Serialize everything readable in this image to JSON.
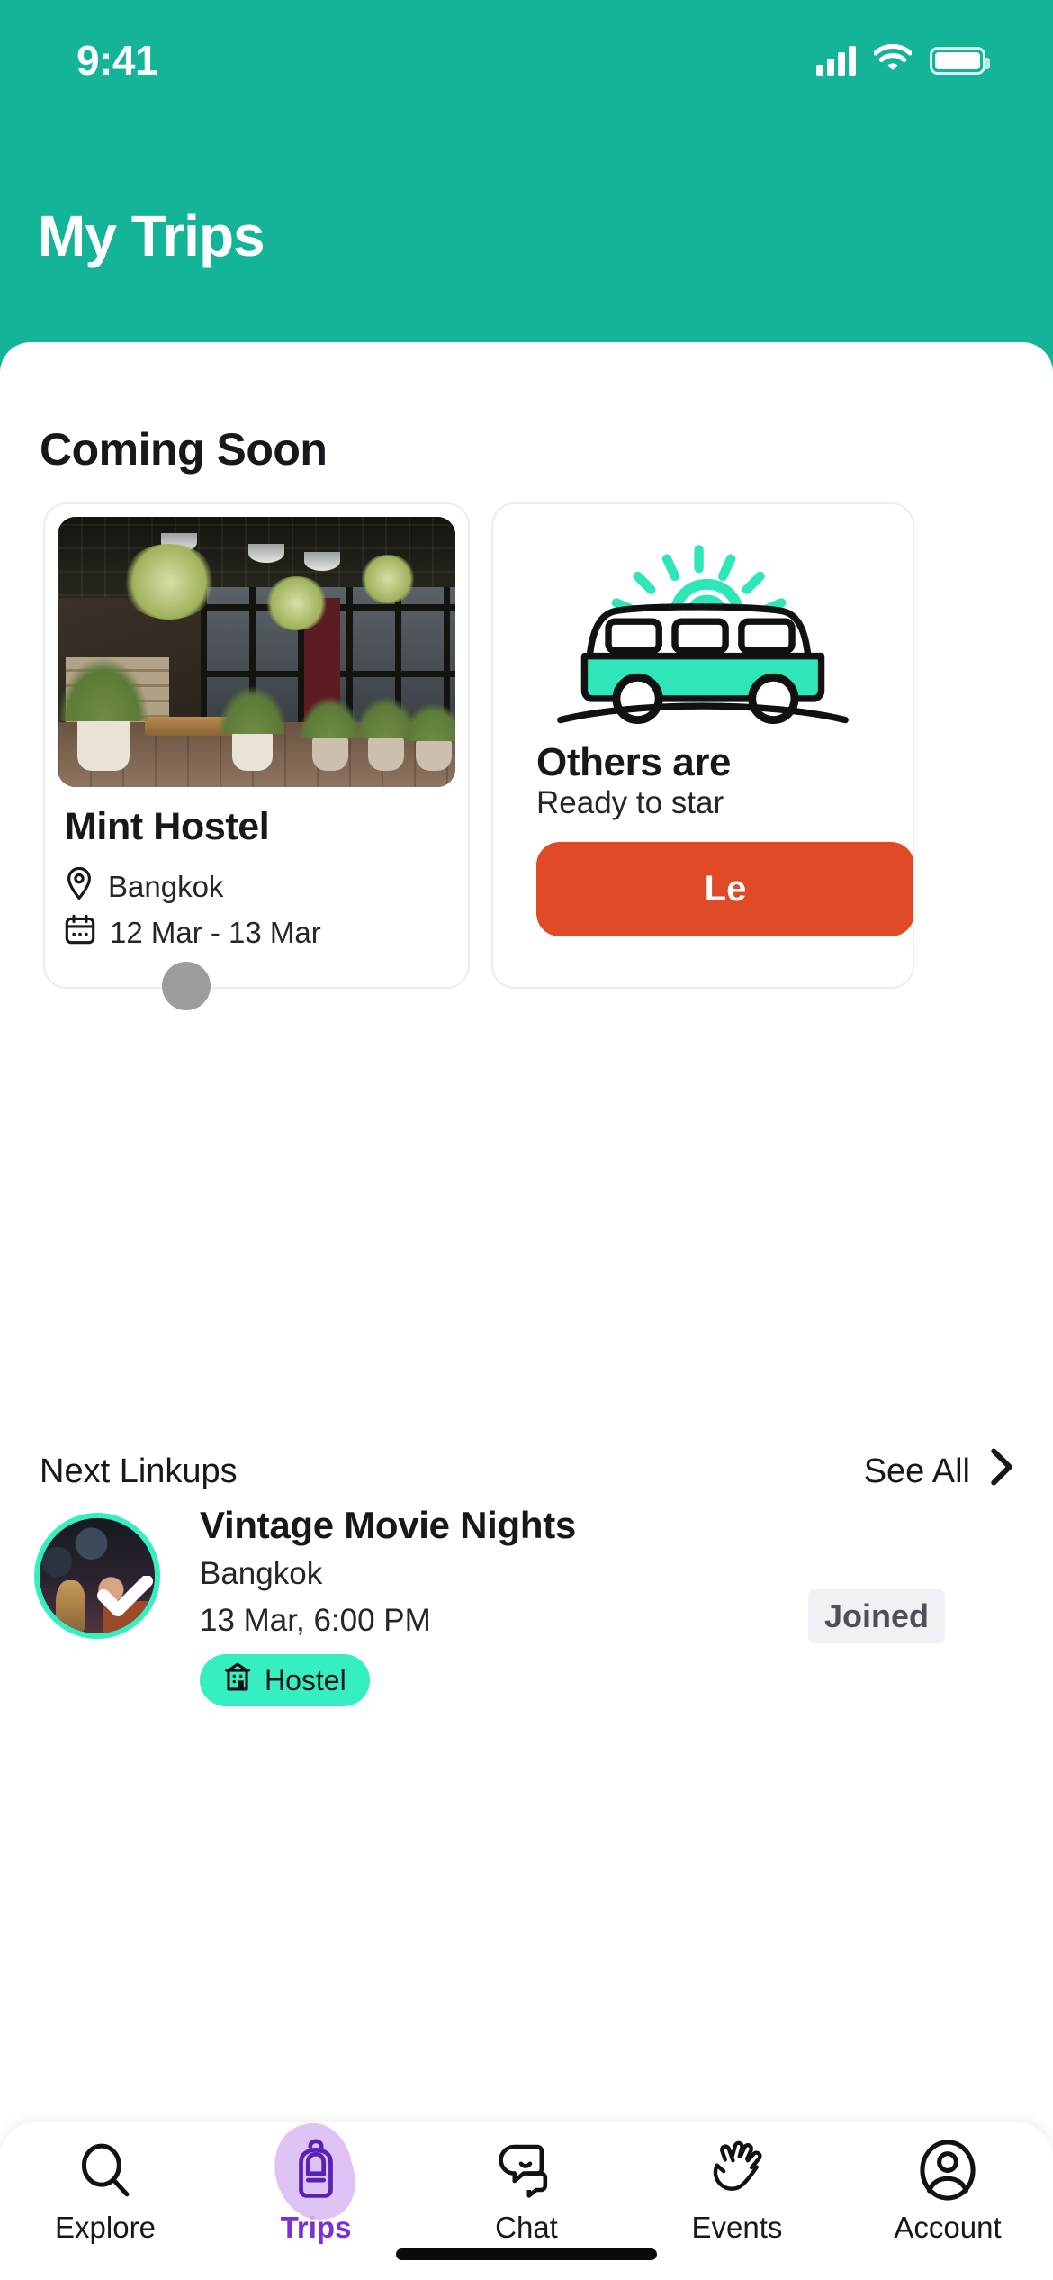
{
  "status_bar": {
    "time": "9:41",
    "cellular_icon": "signal-bars-icon",
    "wifi_icon": "wifi-icon",
    "battery_icon": "battery-icon"
  },
  "header": {
    "title": "My Trips",
    "background_color": "#13B497"
  },
  "main": {
    "section_title": "Coming Soon",
    "trip_card": {
      "photo_alt": "hostel-exterior-photo",
      "name": "Mint Hostel",
      "location_icon": "location-pin-icon",
      "location": "Bangkok",
      "date_icon": "calendar-icon",
      "dates": "12 Mar - 13 Mar",
      "avatar_icon": "member-avatar"
    },
    "promo_card": {
      "illustration": "camper-van-icon",
      "title": "Others are",
      "subtitle": "Ready to star",
      "button_label": "Le",
      "button_color": "#E04A26"
    }
  },
  "linkups": {
    "heading": "Next Linkups",
    "see_all_label": "See All",
    "see_all_icon": "chevron-right-icon",
    "items": [
      {
        "avatar_icon": "linkup-avatar",
        "check_icon": "check-icon",
        "title": "Vintage Movie Nights",
        "location": "Bangkok",
        "time": "13 Mar, 6:00 PM",
        "tag_icon": "hostel-building-icon",
        "tag_label": "Hostel",
        "status_badge": "Joined"
      }
    ]
  },
  "tab_bar": {
    "active_color": "#7B2FD4",
    "items": [
      {
        "label": "Explore",
        "icon": "search-icon",
        "active": false
      },
      {
        "label": "Trips",
        "icon": "backpack-icon",
        "active": true
      },
      {
        "label": "Chat",
        "icon": "chat-bubbles-icon",
        "active": false
      },
      {
        "label": "Events",
        "icon": "waving-hands-icon",
        "active": false
      },
      {
        "label": "Account",
        "icon": "person-circle-icon",
        "active": false
      }
    ]
  },
  "colors": {
    "brand_teal": "#13B497",
    "mint_accent": "#35EFC1",
    "orange": "#E04A26",
    "purple": "#7B2FD4"
  }
}
